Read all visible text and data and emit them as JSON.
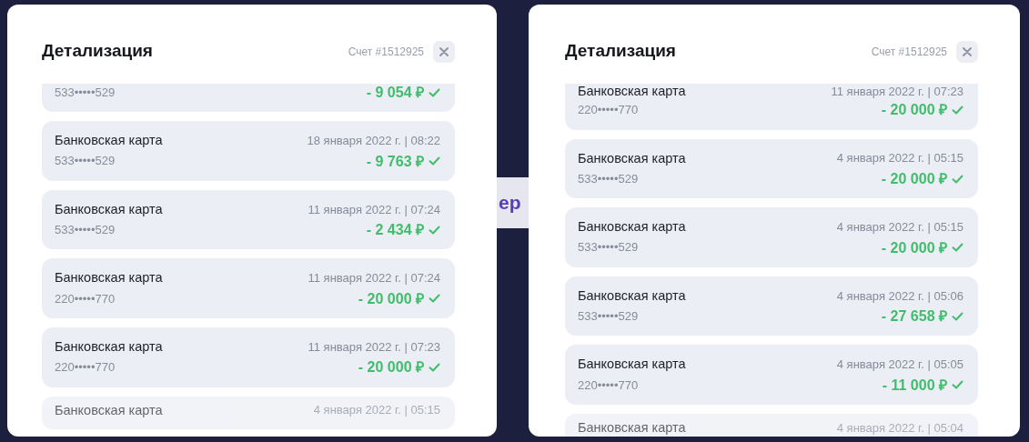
{
  "panels": [
    {
      "title": "Детализация",
      "account": "Счет #1512925",
      "rows": [
        {
          "kind": "top",
          "number": "533•••••529",
          "amount": "- 9 054 ₽",
          "confirmed": true
        },
        {
          "kind": "full",
          "name": "Банковская карта",
          "date": "18 января 2022 г. | 08:22",
          "number": "533•••••529",
          "amount": "- 9 763 ₽",
          "confirmed": true
        },
        {
          "kind": "full",
          "name": "Банковская карта",
          "date": "11 января 2022 г. | 07:24",
          "number": "533•••••529",
          "amount": "- 2 434 ₽",
          "confirmed": true
        },
        {
          "kind": "full",
          "name": "Банковская карта",
          "date": "11 января 2022 г. | 07:24",
          "number": "220•••••770",
          "amount": "- 20 000 ₽",
          "confirmed": true
        },
        {
          "kind": "full",
          "name": "Банковская карта",
          "date": "11 января 2022 г. | 07:23",
          "number": "220•••••770",
          "amount": "- 20 000 ₽",
          "confirmed": true
        },
        {
          "kind": "bottom",
          "name": "Банковская карта",
          "date": "4 января 2022 г. | 05:15"
        }
      ]
    },
    {
      "title": "Детализация",
      "account": "Счет #1512925",
      "rows": [
        {
          "kind": "top",
          "name": "Банковская карта",
          "date": "11 января 2022 г. | 07:23",
          "number": "220•••••770",
          "amount": "- 20 000 ₽",
          "confirmed": true
        },
        {
          "kind": "full",
          "name": "Банковская карта",
          "date": "4 января 2022 г. | 05:15",
          "number": "533•••••529",
          "amount": "- 20 000 ₽",
          "confirmed": true
        },
        {
          "kind": "full",
          "name": "Банковская карта",
          "date": "4 января 2022 г. | 05:15",
          "number": "533•••••529",
          "amount": "- 20 000 ₽",
          "confirmed": true
        },
        {
          "kind": "full",
          "name": "Банковская карта",
          "date": "4 января 2022 г. | 05:06",
          "number": "533•••••529",
          "amount": "- 27 658 ₽",
          "confirmed": true
        },
        {
          "kind": "full",
          "name": "Банковская карта",
          "date": "4 января 2022 г. | 05:05",
          "number": "220•••••770",
          "amount": "- 11 000 ₽",
          "confirmed": true
        },
        {
          "kind": "bottom",
          "name": "Банковская карта",
          "date": "4 января 2022 г. | 05:04"
        }
      ]
    }
  ],
  "background_text": "ер"
}
